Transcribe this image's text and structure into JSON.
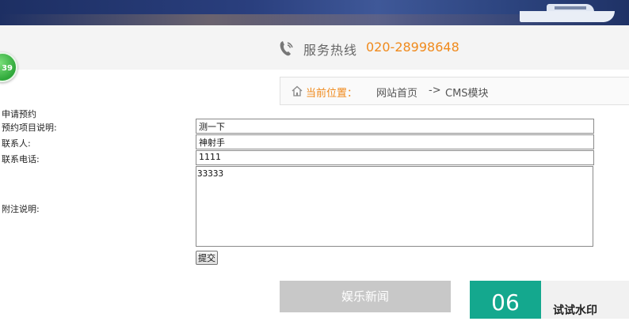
{
  "header": {
    "hotline_label": "服务热线",
    "hotline_number": "020-28998648",
    "badge_count": "39"
  },
  "breadcrumb": {
    "current_label": "当前位置：",
    "home": "网站首页",
    "separator": "->",
    "section": "CMS模块"
  },
  "form": {
    "title": "申请预约",
    "fields": [
      {
        "label": "预约项目说明:",
        "value": "测一下"
      },
      {
        "label": "联系人:",
        "value": "神射手"
      },
      {
        "label": "联系电话:",
        "value": "1111"
      }
    ],
    "note_label": "附注说明:",
    "note_value": "33333",
    "submit_label": "提交"
  },
  "footer": {
    "news_tab": "娱乐新闻",
    "date_day": "06",
    "item_title": "试试水印"
  },
  "colors": {
    "accent_orange": "#f08a1c",
    "teal": "#14a88e",
    "badge_green": "#2fa83a"
  }
}
